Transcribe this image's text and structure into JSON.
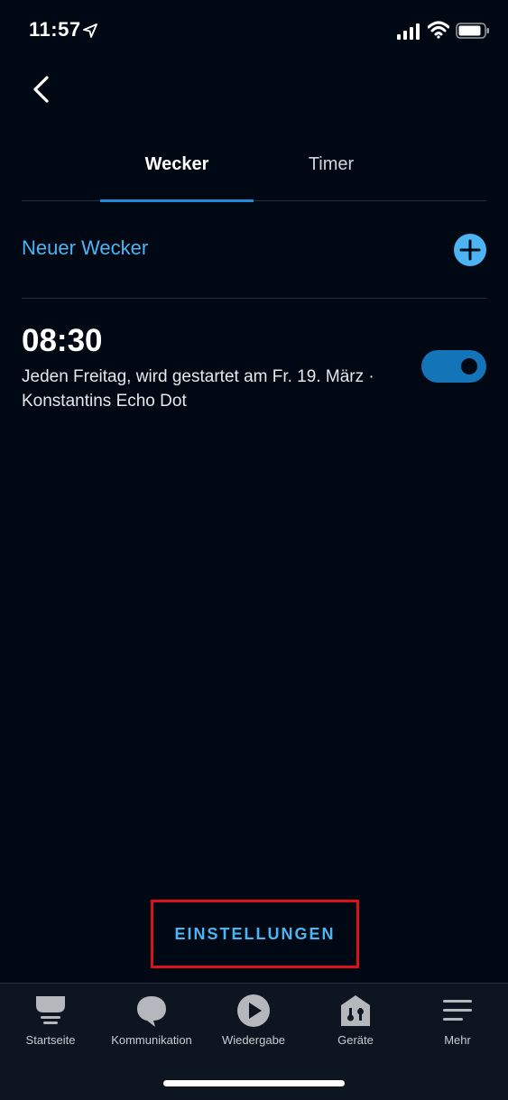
{
  "status_bar": {
    "time": "11:57",
    "icons": [
      "location-arrow-icon",
      "cellular-signal-icon",
      "wifi-icon",
      "battery-icon"
    ]
  },
  "header": {
    "back_icon": "chevron-left-icon"
  },
  "tabs": [
    {
      "label": "Wecker",
      "active": true
    },
    {
      "label": "Timer",
      "active": false
    }
  ],
  "new_alarm": {
    "label": "Neuer Wecker",
    "icon": "plus-circle-icon"
  },
  "alarms": [
    {
      "time": "08:30",
      "description": "Jeden Freitag, wird gestartet am Fr. 19. März · Konstantins Echo Dot",
      "enabled": true
    }
  ],
  "settings": {
    "label": "EINSTELLUNGEN"
  },
  "bottom_nav": [
    {
      "label": "Startseite",
      "icon": "home-icon"
    },
    {
      "label": "Kommunikation",
      "icon": "chat-bubble-icon"
    },
    {
      "label": "Wiedergabe",
      "icon": "play-icon"
    },
    {
      "label": "Geräte",
      "icon": "devices-house-icon"
    },
    {
      "label": "Mehr",
      "icon": "menu-icon"
    }
  ],
  "colors": {
    "background": "#000814",
    "accent": "#4cb4f2",
    "toggle_on": "#1474b8",
    "tab_indicator": "#1e8cd6",
    "highlight_border": "#e0101a"
  }
}
